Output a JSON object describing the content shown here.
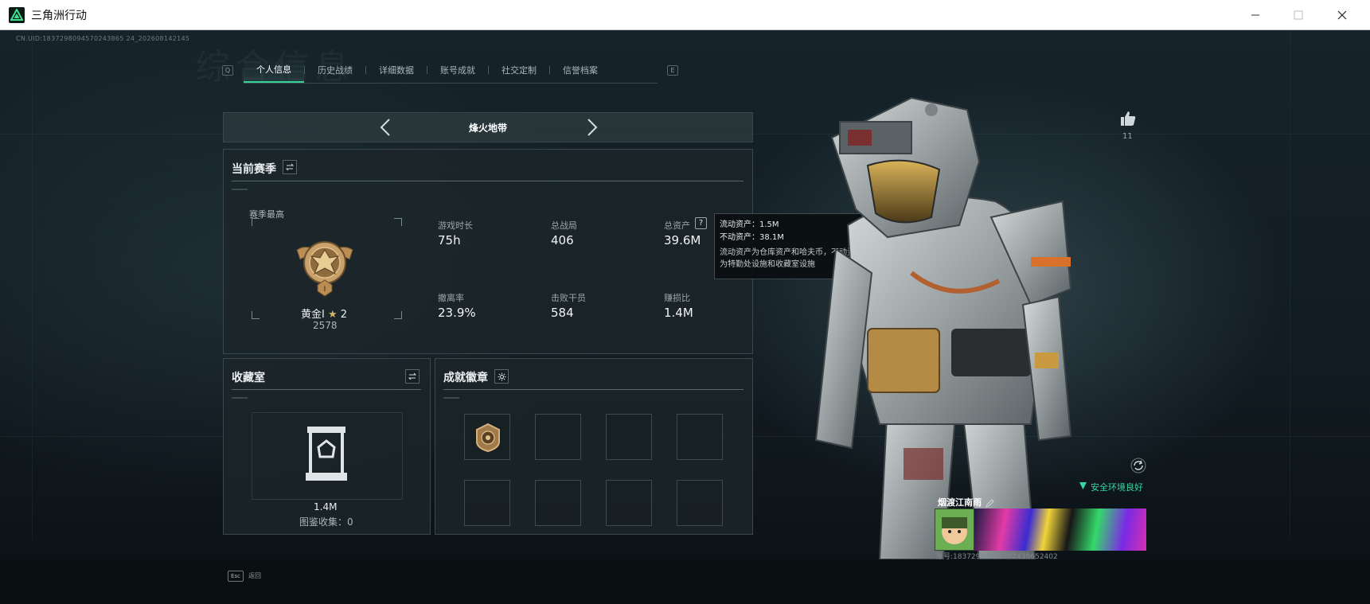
{
  "window": {
    "title": "三角洲行动",
    "minimize_icon": "minimize-icon",
    "maximize_icon": "maximize-icon",
    "close_icon": "close-icon"
  },
  "header": {
    "uid": "CN.UID:1837298094570243865 24_202608142145",
    "watermark": "综合信息"
  },
  "tabs": {
    "left_key": "Q",
    "right_key": "E",
    "items": [
      {
        "label": "个人信息",
        "active": true
      },
      {
        "label": "历史战绩",
        "active": false
      },
      {
        "label": "详细数据",
        "active": false
      },
      {
        "label": "账号成就",
        "active": false
      },
      {
        "label": "社交定制",
        "active": false
      },
      {
        "label": "信誉档案",
        "active": false
      }
    ]
  },
  "mode": {
    "label": "烽火地带"
  },
  "season": {
    "title": "当前赛季",
    "best_label": "赛季最高",
    "rank_name": "黄金I",
    "rank_stars": "2",
    "rank_points": "2578",
    "stats": [
      {
        "label": "游戏时长",
        "value": "75h"
      },
      {
        "label": "总战局",
        "value": "406"
      },
      {
        "label": "总资产",
        "value": "39.6M"
      },
      {
        "label": "撤离率",
        "value": "23.9%"
      },
      {
        "label": "击败干员",
        "value": "584"
      },
      {
        "label": "赚损比",
        "value": "1.4M"
      }
    ]
  },
  "tooltip": {
    "liquid": "流动资产：1.5M",
    "fixed": "不动资产：38.1M",
    "desc_line1": "流动资产为仓库资产和哈夫币，不动资产",
    "desc_line2": "为特勤处设施和收藏室设施"
  },
  "collection": {
    "title": "收藏室",
    "value": "1.4M",
    "count": "图鉴收集：0"
  },
  "achievements": {
    "title": "成就徽章"
  },
  "profile": {
    "like_count": "11",
    "safety_text": "安全环境良好",
    "player_name": "烟渡江南雨",
    "player_id": "账号:18372980945702438652402"
  },
  "footer": {
    "esc_key": "Esc",
    "esc_label": "返回"
  },
  "colors": {
    "accent": "#36d399",
    "panel": "#1c262a",
    "text": "#e9eeef"
  }
}
